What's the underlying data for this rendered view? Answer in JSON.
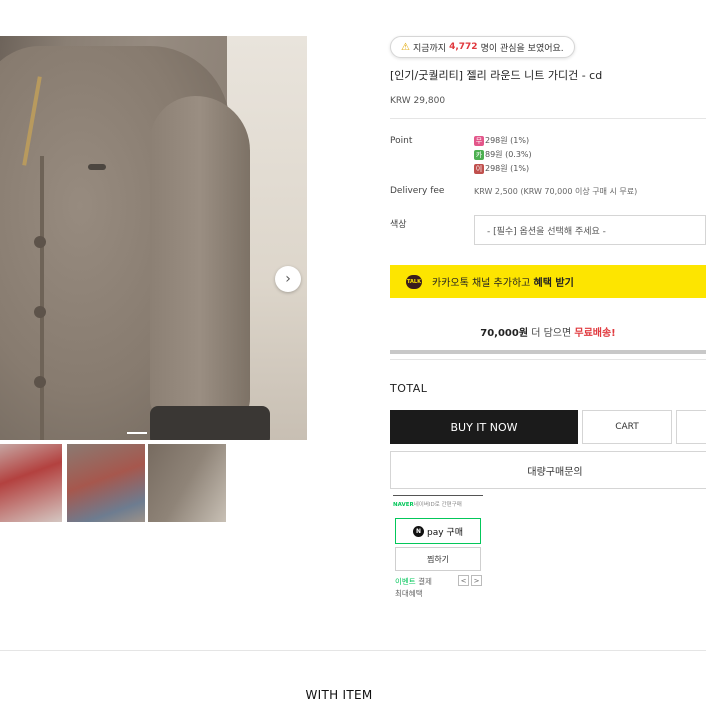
{
  "popular": {
    "warning_icon": "warning-icon",
    "prefix": "지금까지",
    "count": "4,772",
    "suffix": "명이 관심을 보였어요."
  },
  "product": {
    "title": "[인기/굿퀄리티] 젤리 라운드 니트 가디건 - cd",
    "price": "KRW 29,800"
  },
  "point": {
    "label": "Point",
    "items": [
      {
        "badge": "무",
        "badge_color": "#e3568a",
        "text": "298원 (1%)"
      },
      {
        "badge": "카",
        "badge_color": "#4caf50",
        "text": "89원 (0.3%)"
      },
      {
        "badge": "이",
        "badge_color": "#c0504d",
        "text": "298원 (1%)"
      }
    ]
  },
  "delivery": {
    "label": "Delivery fee",
    "value": "KRW 2,500 (KRW 70,000 이상 구매 시 무료)"
  },
  "color": {
    "label": "색상",
    "select_value": "- [필수] 옵션을 선택해 주세요 -"
  },
  "kakao": {
    "icon_text": "TALK",
    "text_prefix": "카카오톡 채널 추가하고 ",
    "text_bold": "혜택 받기"
  },
  "free_shipping": {
    "amount": "70,000원",
    "middle": " 더 담으면 ",
    "highlight": "무료배송!",
    "progress": 0
  },
  "total_label": "TOTAL",
  "buttons": {
    "buy_now": "BUY IT NOW",
    "cart": "CART",
    "bulk": "대량구매문의"
  },
  "npay": {
    "naver": "NAVER",
    "top_text": "네이버ID로 간편구매",
    "pay_label": "pay 구매",
    "n_letter": "N",
    "wish_label": "찜하기",
    "event": "이벤트",
    "event_rest": " 결제",
    "benefit": "최대혜택",
    "prev": "<",
    "next": ">"
  },
  "section_title": "WITH ITEM",
  "gallery": {
    "next_icon": "chevron-right-icon",
    "next_glyph": "›"
  }
}
